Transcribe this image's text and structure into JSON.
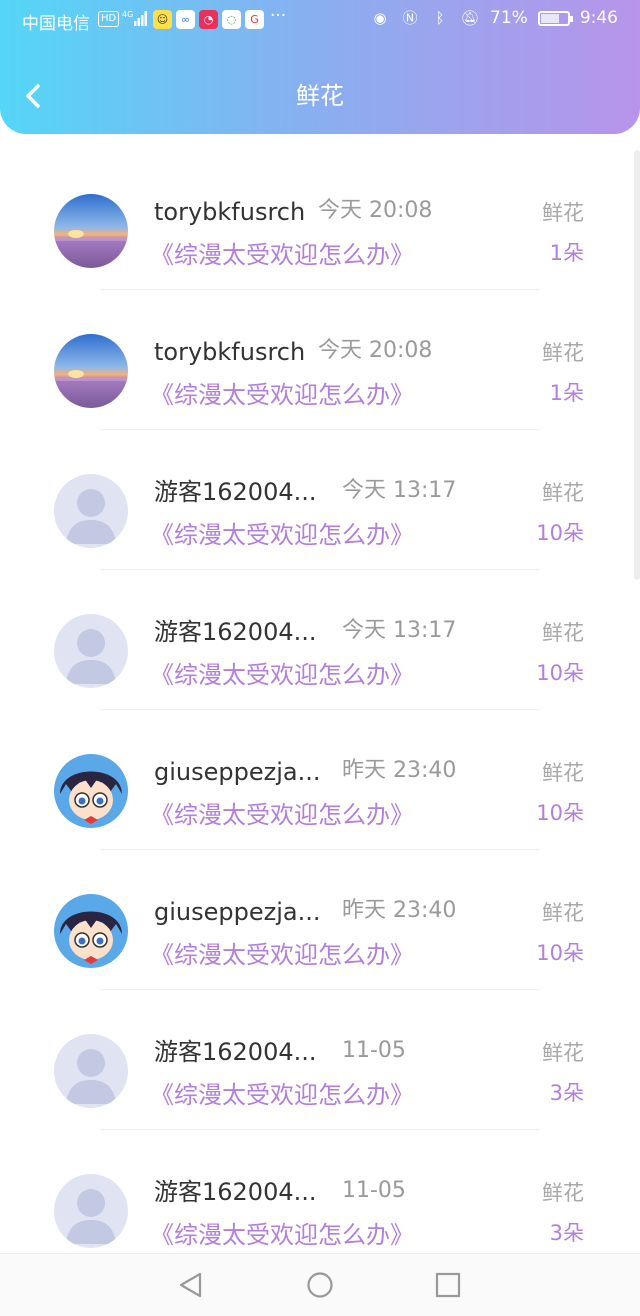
{
  "status_bar": {
    "carrier": "中国电信",
    "hd": "HD",
    "network": "4G",
    "battery_percent": "71%",
    "battery_level": 0.71,
    "time": "9:46"
  },
  "header": {
    "title": "鲜花"
  },
  "rows": [
    {
      "name": "torybkfusrch",
      "time": "今天 20:08",
      "book": "《综漫太受欢迎怎么办》",
      "gift": "鲜花",
      "count": "1朵",
      "avatar": "sunset"
    },
    {
      "name": "torybkfusrch",
      "time": "今天 20:08",
      "book": "《综漫太受欢迎怎么办》",
      "gift": "鲜花",
      "count": "1朵",
      "avatar": "sunset"
    },
    {
      "name": "游客162004...",
      "time": "今天 13:17",
      "book": "《综漫太受欢迎怎么办》",
      "gift": "鲜花",
      "count": "10朵",
      "avatar": "default"
    },
    {
      "name": "游客162004...",
      "time": "今天 13:17",
      "book": "《综漫太受欢迎怎么办》",
      "gift": "鲜花",
      "count": "10朵",
      "avatar": "default"
    },
    {
      "name": "giuseppezja...",
      "time": "昨天 23:40",
      "book": "《综漫太受欢迎怎么办》",
      "gift": "鲜花",
      "count": "10朵",
      "avatar": "anime"
    },
    {
      "name": "giuseppezja...",
      "time": "昨天 23:40",
      "book": "《综漫太受欢迎怎么办》",
      "gift": "鲜花",
      "count": "10朵",
      "avatar": "anime"
    },
    {
      "name": "游客162004...",
      "time": "11-05",
      "book": "《综漫太受欢迎怎么办》",
      "gift": "鲜花",
      "count": "3朵",
      "avatar": "default"
    },
    {
      "name": "游客162004...",
      "time": "11-05",
      "book": "《综漫太受欢迎怎么办》",
      "gift": "鲜花",
      "count": "3朵",
      "avatar": "default"
    }
  ],
  "colors": {
    "header_gradient_start": "#54d6f7",
    "header_gradient_end": "#b894ea",
    "accent_purple": "#b27fdc",
    "name_text": "#333333",
    "meta_text": "#9a9a9a"
  },
  "icons": {
    "back": "chevron-left-icon",
    "nav_back": "triangle-back-icon",
    "nav_home": "circle-home-icon",
    "nav_recent": "square-recent-icon"
  }
}
